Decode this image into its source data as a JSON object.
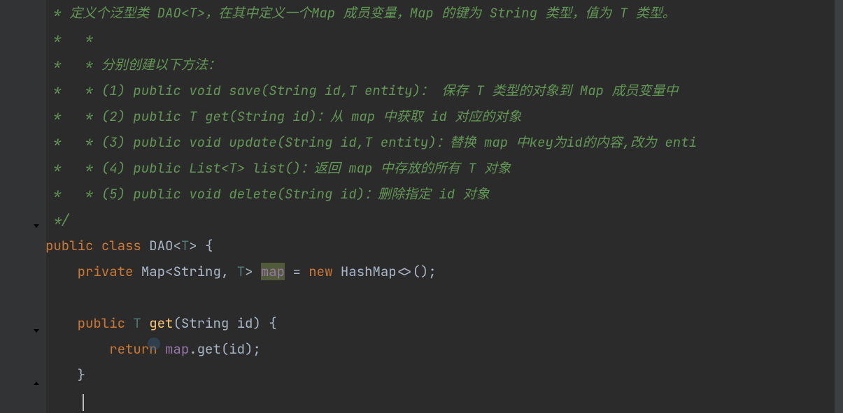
{
  "comments": {
    "line1_prefix": " * ",
    "line1_text": "定义个泛型类 DAO<T>，在其中定义一个Map 成员变量，Map 的键为 String 类型，值为 T 类型。",
    "line2": " *   *",
    "line3": " *   * 分别创建以下方法：",
    "line4": " *   * (1) public void save(String id,T entity)： 保存 T 类型的对象到 Map 成员变量中",
    "line5": " *   * (2) public T get(String id)：从 map 中获取 id 对应的对象",
    "line6": " *   * (3) public void update(String id,T entity)：替换 map 中key为id的内容,改为 enti",
    "line7": " *   * (4) public List<T> list()：返回 map 中存放的所有 T 对象",
    "line8": " *   * (5) public void delete(String id)：删除指定 id 对象",
    "line9": " */"
  },
  "code": {
    "kw_public": "public",
    "kw_class": "class",
    "kw_private": "private",
    "kw_new": "new",
    "kw_return": "return",
    "class_name": "DAO",
    "type_param": "T",
    "type_map": "Map",
    "type_string": "String",
    "type_hashmap": "HashMap",
    "field_map": "map",
    "method_get": "get",
    "param_id": "id",
    "brace_open": "{",
    "brace_close": "}",
    "angle_open": "<",
    "angle_close": ">",
    "paren_open": "(",
    "paren_close": ")",
    "comma": ", ",
    "eq": " = ",
    "semicolon": ";",
    "diamond": "<>()",
    "dot": "."
  }
}
